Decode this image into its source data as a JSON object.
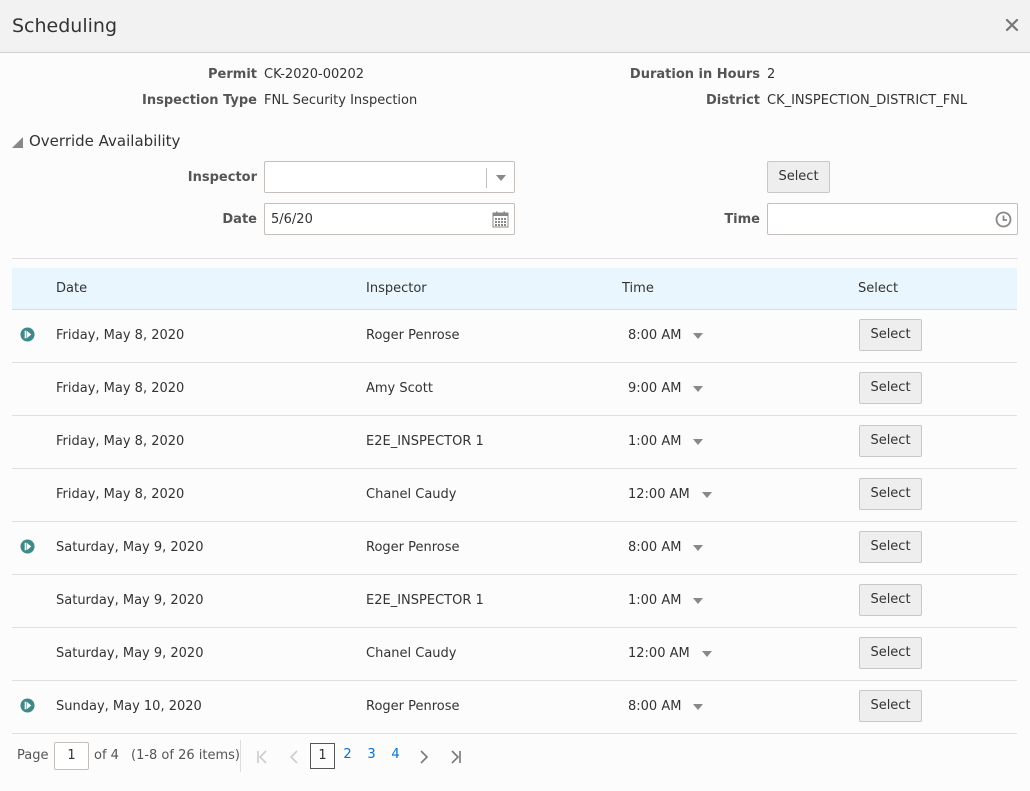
{
  "dialog": {
    "title": "Scheduling",
    "close_icon": "close-icon"
  },
  "info": {
    "permit_label": "Permit",
    "permit_value": "CK-2020-00202",
    "inspection_type_label": "Inspection Type",
    "inspection_type_value": "FNL Security Inspection",
    "duration_label": "Duration in Hours",
    "duration_value": "2",
    "district_label": "District",
    "district_value": "CK_INSPECTION_DISTRICT_FNL"
  },
  "override": {
    "section_label": "Override Availability",
    "expanded": true,
    "inspector_label": "Inspector",
    "inspector_value": "",
    "date_label": "Date",
    "date_value": "5/6/20",
    "time_label": "Time",
    "time_value": "",
    "select_button": "Select"
  },
  "table": {
    "columns": [
      "Date",
      "Inspector",
      "Time",
      "Select"
    ],
    "rows": [
      {
        "date": "Friday, May 8, 2020",
        "inspector": "Roger Penrose",
        "time": "8:00 AM",
        "select": "Select",
        "play_icon": true
      },
      {
        "date": "Friday, May 8, 2020",
        "inspector": "Amy Scott",
        "time": "9:00 AM",
        "select": "Select",
        "play_icon": false
      },
      {
        "date": "Friday, May 8, 2020",
        "inspector": "E2E_INSPECTOR 1",
        "time": "1:00 AM",
        "select": "Select",
        "play_icon": false
      },
      {
        "date": "Friday, May 8, 2020",
        "inspector": "Chanel Caudy",
        "time": "12:00 AM",
        "select": "Select",
        "play_icon": false
      },
      {
        "date": "Saturday, May 9, 2020",
        "inspector": "Roger Penrose",
        "time": "8:00 AM",
        "select": "Select",
        "play_icon": true
      },
      {
        "date": "Saturday, May 9, 2020",
        "inspector": "E2E_INSPECTOR 1",
        "time": "1:00 AM",
        "select": "Select",
        "play_icon": false
      },
      {
        "date": "Saturday, May 9, 2020",
        "inspector": "Chanel Caudy",
        "time": "12:00 AM",
        "select": "Select",
        "play_icon": false
      },
      {
        "date": "Sunday, May 10, 2020",
        "inspector": "Roger Penrose",
        "time": "8:00 AM",
        "select": "Select",
        "play_icon": true
      }
    ]
  },
  "pagination": {
    "page_label": "Page",
    "current_page": "1",
    "of_label": "of 4",
    "items_summary": "(1-8 of 26 items)",
    "pages": [
      "1",
      "2",
      "3",
      "4"
    ]
  },
  "colors": {
    "header_bg": "#f2f2f2",
    "table_header_bg": "#eaf6fd",
    "play_icon": "#3f8a88",
    "link": "#0572ce"
  }
}
